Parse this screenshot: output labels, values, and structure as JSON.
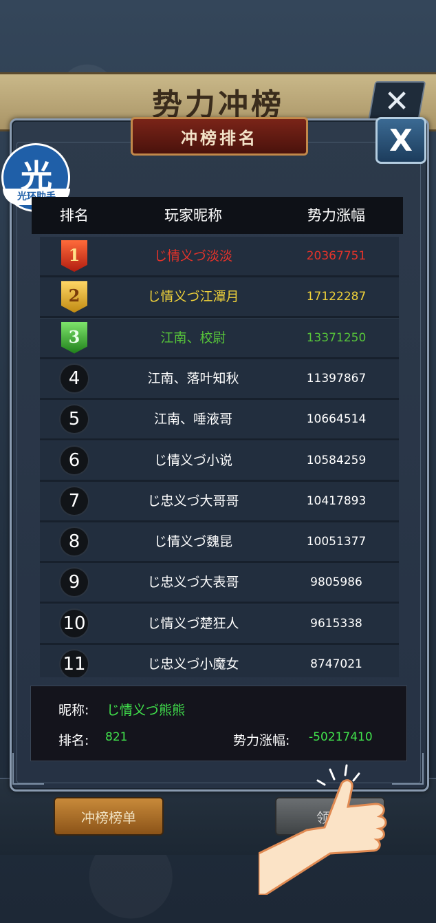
{
  "background": {
    "banner_title": "势力冲榜"
  },
  "dialog": {
    "title": "冲榜排名",
    "close_label": "X"
  },
  "badge": {
    "big": "光",
    "small": "光环助手"
  },
  "table": {
    "headers": [
      "排名",
      "玩家昵称",
      "势力涨幅"
    ],
    "rows": [
      {
        "rank": "1",
        "name": "じ情义づ淡淡",
        "power": "20367751",
        "color": "#e5332a"
      },
      {
        "rank": "2",
        "name": "じ情义づ江潭月",
        "power": "17122287",
        "color": "#f0d23a"
      },
      {
        "rank": "3",
        "name": "江南、校尉",
        "power": "13371250",
        "color": "#57c53a"
      },
      {
        "rank": "4",
        "name": "江南、落叶知秋",
        "power": "11397867",
        "color": "#ffffff"
      },
      {
        "rank": "5",
        "name": "江南、唾液哥",
        "power": "10664514",
        "color": "#ffffff"
      },
      {
        "rank": "6",
        "name": "じ情义づ小说",
        "power": "10584259",
        "color": "#ffffff"
      },
      {
        "rank": "7",
        "name": "じ忠义づ大哥哥",
        "power": "10417893",
        "color": "#ffffff"
      },
      {
        "rank": "8",
        "name": "じ情义づ魏昆",
        "power": "10051377",
        "color": "#ffffff"
      },
      {
        "rank": "9",
        "name": "じ忠义づ大表哥",
        "power": "9805986",
        "color": "#ffffff"
      },
      {
        "rank": "10",
        "name": "じ情义づ楚狂人",
        "power": "9615338",
        "color": "#ffffff"
      },
      {
        "rank": "11",
        "name": "じ忠义づ小魔女",
        "power": "8747021",
        "color": "#ffffff"
      }
    ]
  },
  "my_info": {
    "nickname_label": "昵称:",
    "nickname": "じ情义づ熊熊",
    "rank_label": "排名:",
    "rank": "821",
    "power_label": "势力涨幅:",
    "power": "-50217410"
  },
  "buttons": {
    "ranking_list": "冲榜榜单",
    "claim": "领取"
  }
}
